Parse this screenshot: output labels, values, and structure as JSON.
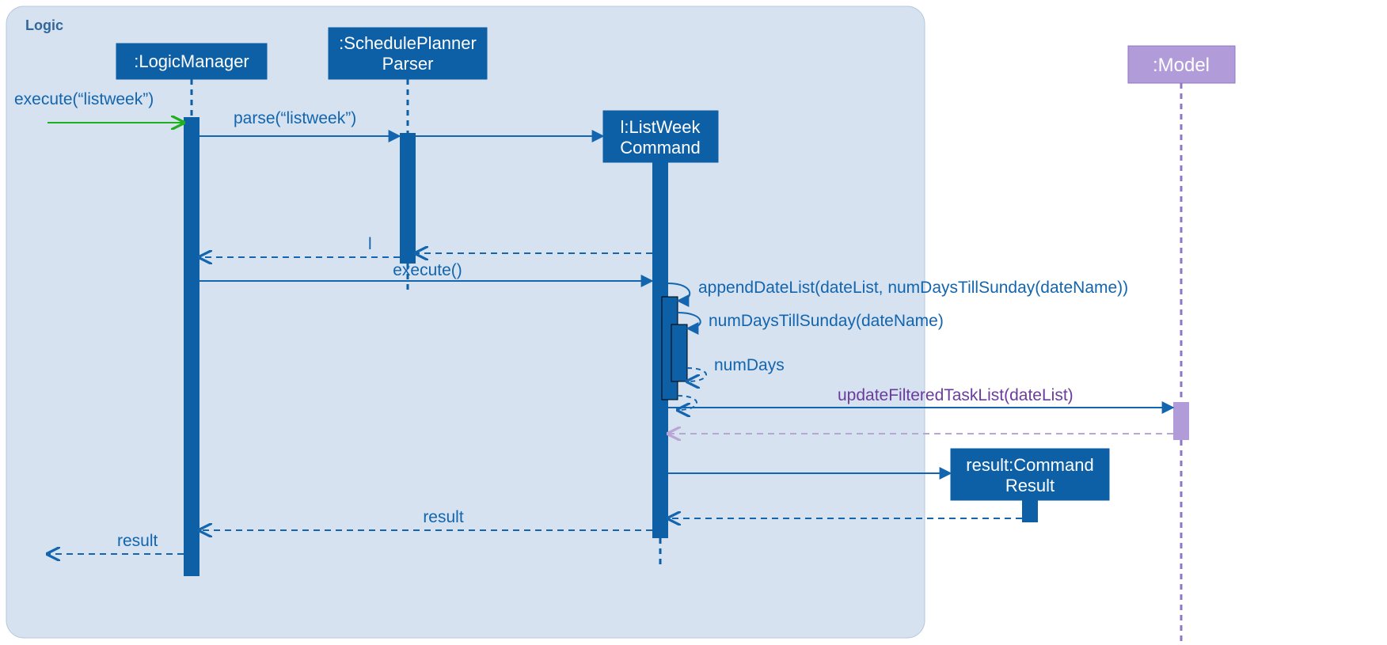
{
  "frame": {
    "label": "Logic"
  },
  "lifelines": {
    "logicManager": {
      "label": ":LogicManager"
    },
    "parser": {
      "line1": ":SchedulePlanner",
      "line2": "Parser"
    },
    "listWeek": {
      "line1": "l:ListWeek",
      "line2": "Command"
    },
    "result": {
      "line1": "result:Command",
      "line2": "Result"
    },
    "model": {
      "label": ":Model"
    }
  },
  "messages": {
    "execListWeek": "execute(“listweek”)",
    "parseListWeek": "parse(“listweek”)",
    "returnL": "l",
    "executeEmpty": "execute()",
    "appendDateList": "appendDateList(dateList, numDaysTillSunday(dateName))",
    "numDaysTill": "numDaysTillSunday(dateName)",
    "numDays": "numDays",
    "updateFiltered": "updateFilteredTaskList(dateList)",
    "resultReturn": "result",
    "resultOut": "result"
  },
  "colors": {
    "blue": "#0d5fa6",
    "frame": "#d6e2ef",
    "green": "#1fb01f",
    "purple": "#b19cd9",
    "purpleDark": "#8560b5"
  }
}
